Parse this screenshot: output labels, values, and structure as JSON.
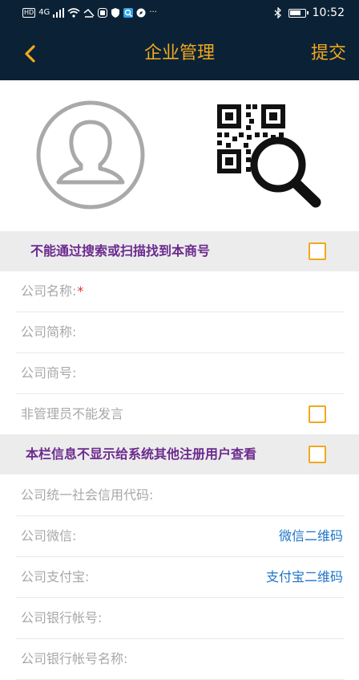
{
  "status_bar": {
    "time": "10:52",
    "network": "4G",
    "icons": [
      "hd-icon",
      "signal-icon",
      "wifi-icon",
      "nfc-icon",
      "app-icon",
      "shield-icon",
      "search-app-icon",
      "compass-icon",
      "more-icon",
      "bluetooth-icon",
      "battery-icon"
    ]
  },
  "header": {
    "back_icon": "chevron-left-icon",
    "title": "企业管理",
    "submit_label": "提交"
  },
  "profile": {
    "avatar_icon": "user-avatar-icon",
    "qr_icon": "qr-code-search-icon"
  },
  "settings": {
    "hide_search": "不能通过搜索或扫描找到本商号",
    "hide_info": "本栏信息不显示给系统其他注册用户查看"
  },
  "form": {
    "company_name": "公司名称:",
    "company_name_required": "*",
    "company_short_name": "公司简称:",
    "company_brand": "公司商号:",
    "non_admin_mute": "非管理员不能发言",
    "credit_code": "公司统一社会信用代码:",
    "wechat": "公司微信:",
    "wechat_qr": "微信二维码",
    "alipay": "公司支付宝:",
    "alipay_qr": "支付宝二维码",
    "bank_account": "公司银行帐号:",
    "bank_account_name": "公司银行帐号名称:"
  },
  "colors": {
    "header_bg": "#0b2236",
    "accent": "#f2a81d",
    "highlight_text": "#6b2a8e",
    "link": "#1d74c8",
    "placeholder": "#a8a8a8"
  }
}
